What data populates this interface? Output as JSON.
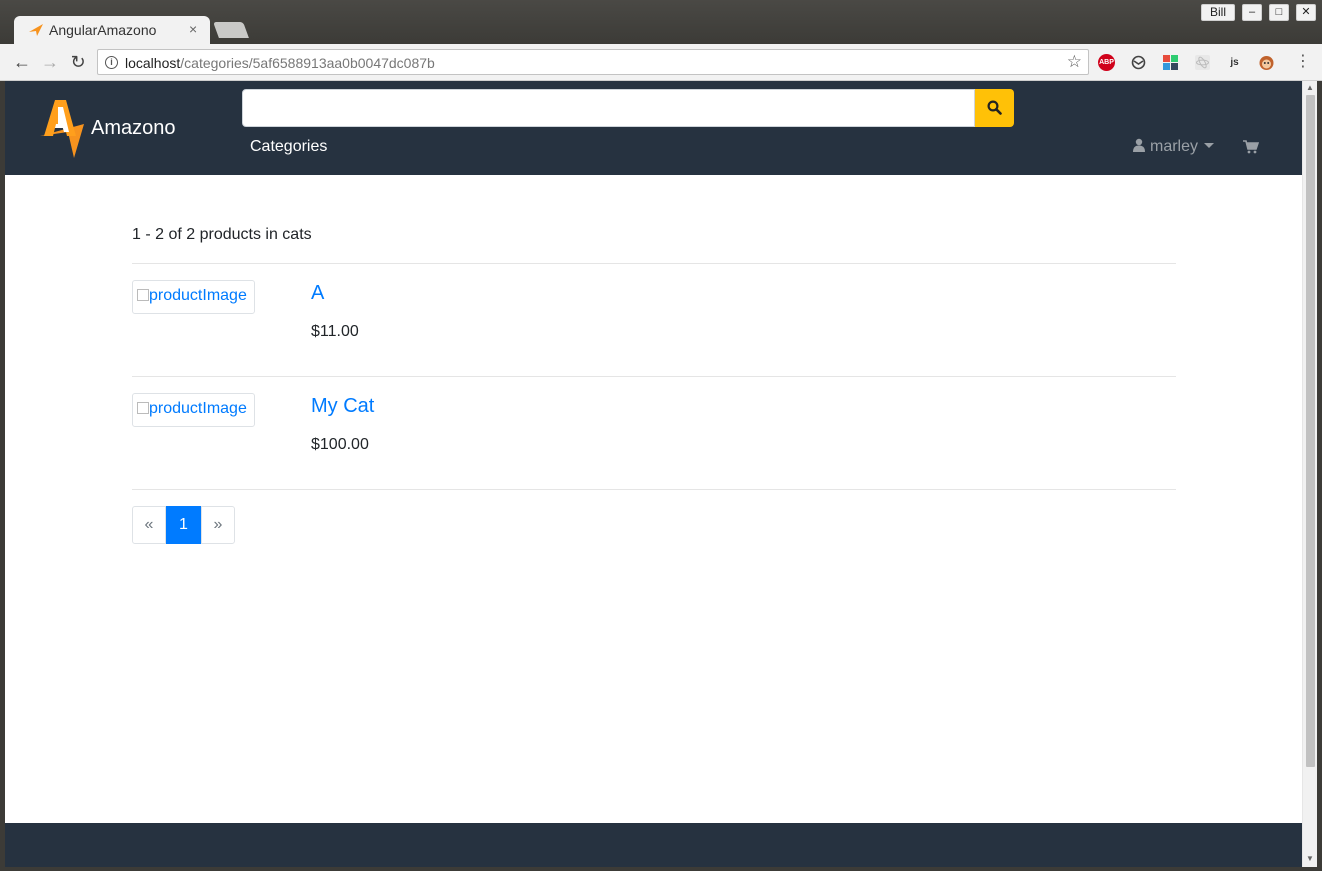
{
  "window": {
    "user_label": "Bill",
    "minimize": "–",
    "maximize": "□",
    "close": "✕"
  },
  "tab": {
    "title": "AngularAmazono",
    "close": "×"
  },
  "toolbar": {
    "back": "←",
    "forward": "→",
    "reload": "↻",
    "url_host": "localhost",
    "url_path": "/categories/5af6588913aa0b0047dc087b",
    "star": "☆",
    "ext_abp": "ABP",
    "ext_js": "js",
    "menu": "⋮"
  },
  "nav": {
    "brand": "Amazono",
    "search_placeholder": "",
    "categories": "Categories",
    "user": "marley"
  },
  "summary": "1 - 2 of 2 products in cats",
  "products": [
    {
      "image_alt": "productImage",
      "name": "A",
      "price": "$11.00"
    },
    {
      "image_alt": "productImage",
      "name": "My Cat",
      "price": "$100.00"
    }
  ],
  "pagination": {
    "prev": "«",
    "current": "1",
    "next": "»"
  },
  "colors": {
    "navbar": "#263240",
    "search_button": "#ffc107",
    "link": "#007bff",
    "active_page": "#007bff"
  }
}
